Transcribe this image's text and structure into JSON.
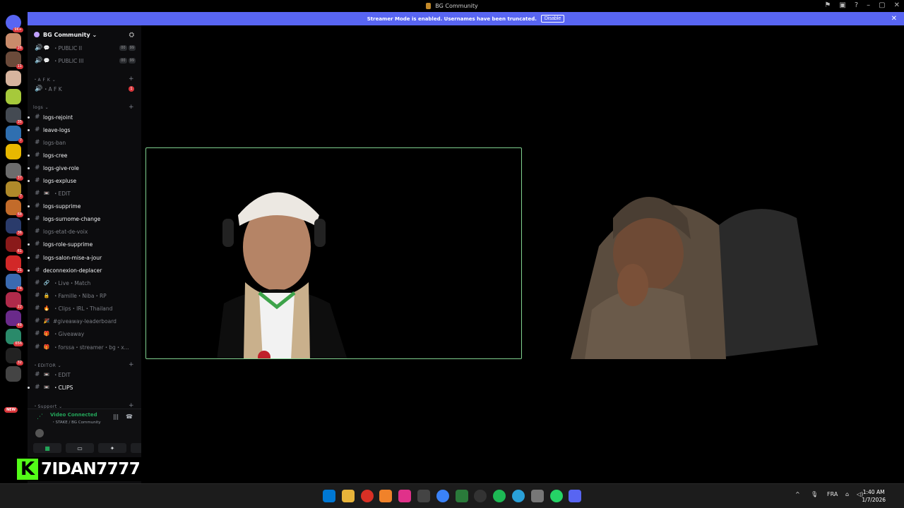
{
  "window": {
    "title": "BG Community"
  },
  "banner": {
    "message": "Streamer Mode is enabled. Usernames have been truncated.",
    "disable_label": "Disable"
  },
  "servers": [
    {
      "badge": "9K+",
      "color": "#5865f2"
    },
    {
      "badge": "26",
      "color": "#c98b6b"
    },
    {
      "badge": "11",
      "color": "#6b4a3a"
    },
    {
      "badge": "",
      "color": "#d7b49e"
    },
    {
      "badge": "",
      "color": "#a6c93b"
    },
    {
      "badge": "35",
      "color": "#444a52"
    },
    {
      "badge": "7",
      "color": "#2f6fb0"
    },
    {
      "badge": "",
      "color": "#e8b800"
    },
    {
      "badge": "37",
      "color": "#6c6c6c"
    },
    {
      "badge": "7",
      "color": "#b08a2a"
    },
    {
      "badge": "68",
      "color": "#c26b2a"
    },
    {
      "badge": "36",
      "color": "#2a3b6b"
    },
    {
      "badge": "61",
      "color": "#8a1a1a"
    },
    {
      "badge": "21",
      "color": "#d22828"
    },
    {
      "badge": "74",
      "color": "#3a6ab0"
    },
    {
      "badge": "22",
      "color": "#b02a4a"
    },
    {
      "badge": "48",
      "color": "#6a2a8a"
    },
    {
      "badge": "656",
      "color": "#2a8a6a"
    },
    {
      "badge": "32",
      "color": "#222"
    },
    {
      "badge": "",
      "color": "#444"
    }
  ],
  "server_new_label": "NEW",
  "guild": {
    "name": "BG Community ⌄"
  },
  "channels": [
    {
      "kind": "voice",
      "prefix": "💬",
      "label": "・PUBLIC II",
      "vol": [
        "00",
        "99"
      ],
      "style": "dim"
    },
    {
      "kind": "voice",
      "prefix": "💬",
      "label": "・PUBLIC III",
      "vol": [
        "00",
        "99"
      ],
      "style": "dim"
    },
    {
      "kind": "category",
      "label": "・A F K ⌄"
    },
    {
      "kind": "voice",
      "prefix": "",
      "label": "・A F K",
      "badge": "1",
      "style": "dim"
    },
    {
      "kind": "category",
      "label": "logs ⌄"
    },
    {
      "kind": "text",
      "label": "logs-rejoint",
      "style": "bright"
    },
    {
      "kind": "text",
      "label": "leave-logs",
      "style": "bright"
    },
    {
      "kind": "text",
      "label": "logs-ban",
      "style": "dim"
    },
    {
      "kind": "text",
      "label": "logs-cree",
      "style": "bright"
    },
    {
      "kind": "text",
      "label": "logs-give-role",
      "style": "bright"
    },
    {
      "kind": "text",
      "label": "logs-expluse",
      "style": "bright"
    },
    {
      "kind": "text",
      "prefix": "📼",
      "label": "・EDIT",
      "style": "dim"
    },
    {
      "kind": "text",
      "label": "logs-supprime",
      "style": "bright"
    },
    {
      "kind": "text",
      "label": "logs-surnome-change",
      "style": "bright"
    },
    {
      "kind": "text",
      "label": "logs-etat-de-voix",
      "style": "dim"
    },
    {
      "kind": "text",
      "label": "logs-role-supprime",
      "style": "bright"
    },
    {
      "kind": "text",
      "label": "logs-salon-mise-a-jour",
      "style": "bright"
    },
    {
      "kind": "text",
      "label": "deconnexion-deplacer",
      "style": "bright"
    },
    {
      "kind": "text",
      "prefix": "🔗",
      "label": "・Live・Match",
      "style": "dim"
    },
    {
      "kind": "text",
      "prefix": "🔒",
      "label": "・Famille・Niba・RP",
      "style": "dim"
    },
    {
      "kind": "text",
      "prefix": "🔥",
      "label": "・Clips・IRL・Thailand",
      "style": "dim"
    },
    {
      "kind": "text",
      "prefix": "🎉",
      "label": "#giveaway-leaderboard",
      "style": "dim"
    },
    {
      "kind": "text",
      "prefix": "🎁",
      "label": "・Giveaway",
      "style": "dim"
    },
    {
      "kind": "text",
      "prefix": "🎁",
      "label": "・forssa・streamer・bg・x...",
      "style": "dim"
    },
    {
      "kind": "category",
      "label": "・EDITOR ⌄"
    },
    {
      "kind": "text",
      "prefix": "📼",
      "label": "・EDIT",
      "style": "dim"
    },
    {
      "kind": "text",
      "prefix": "📼",
      "label": "・CLIPS",
      "style": "bright"
    },
    {
      "kind": "category",
      "label": "・Support ⌄"
    }
  ],
  "voice": {
    "status": "Video Connected",
    "location": "・STAKE / BG Community"
  },
  "streamer": {
    "logo": "K",
    "name": "7IDAN7777"
  },
  "tray": {
    "lang": "FRA",
    "time": "1:40 AM",
    "date": "1/7/2026"
  },
  "taskbar_apps": [
    {
      "name": "windows-start-icon",
      "color": "#0078d4"
    },
    {
      "name": "file-explorer-icon",
      "color": "#e8b43a"
    },
    {
      "name": "chrome-icon",
      "color": "#d93025"
    },
    {
      "name": "app-a-icon",
      "color": "#f0822a"
    },
    {
      "name": "app-camera-icon",
      "color": "#e0318a"
    },
    {
      "name": "app-pen-icon",
      "color": "#444"
    },
    {
      "name": "chrome-alt-icon",
      "color": "#3a82f7"
    },
    {
      "name": "app-play-icon",
      "color": "#2a7a3a"
    },
    {
      "name": "obs-icon",
      "color": "#333"
    },
    {
      "name": "spotify-icon",
      "color": "#1db954"
    },
    {
      "name": "telegram-icon",
      "color": "#2aa0d8"
    },
    {
      "name": "settings-icon",
      "color": "#777"
    },
    {
      "name": "whatsapp-icon",
      "color": "#25d366"
    },
    {
      "name": "discord-icon",
      "color": "#5865f2"
    }
  ]
}
